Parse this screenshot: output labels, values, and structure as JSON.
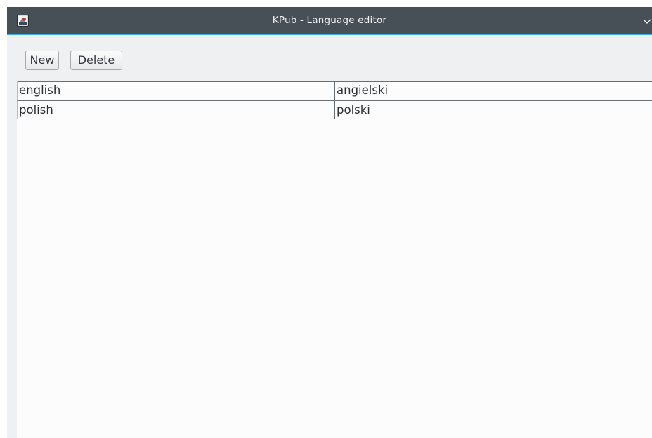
{
  "window": {
    "title": "KPub - Language editor",
    "title_color": "#eff0f1",
    "titlebar_color": "#475057",
    "accent_color": "#3daee9"
  },
  "icons": {
    "app": "app-icon",
    "menu": "chevron-down-icon"
  },
  "toolbar": {
    "new_label": "New",
    "delete_label": "Delete"
  },
  "table": {
    "rows": [
      {
        "key": "english",
        "value": "angielski"
      },
      {
        "key": "polish",
        "value": "polski"
      }
    ]
  }
}
